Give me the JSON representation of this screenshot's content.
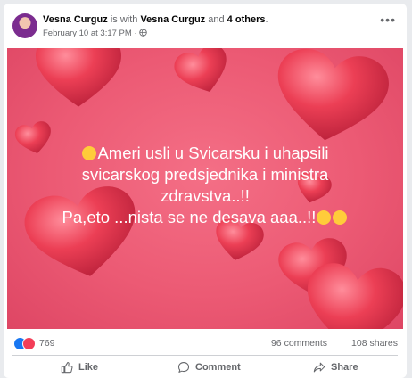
{
  "post": {
    "author": "Vesna Curguz",
    "with_text": "is with",
    "tagged": "Vesna Curguz",
    "and_text": "and",
    "others": "4 others",
    "period": ".",
    "date": "February 10 at 3:17 PM",
    "separator": "·",
    "lines": [
      "Ameri usli u Svicarsku i uhapsili",
      "svicarskog predsjednika i ministra",
      "zdravstva..!!",
      "Pa,eto ...nista se ne desava aaa..!!"
    ]
  },
  "stats": {
    "reactions": "769",
    "comments": "96 comments",
    "shares": "108 shares"
  },
  "actions": {
    "like": "Like",
    "comment": "Comment",
    "share": "Share"
  },
  "colors": {
    "background_pink": "#ec5a74",
    "heart": "#e5394f",
    "like_blue": "#1877f2",
    "love_red": "#f33e58"
  }
}
